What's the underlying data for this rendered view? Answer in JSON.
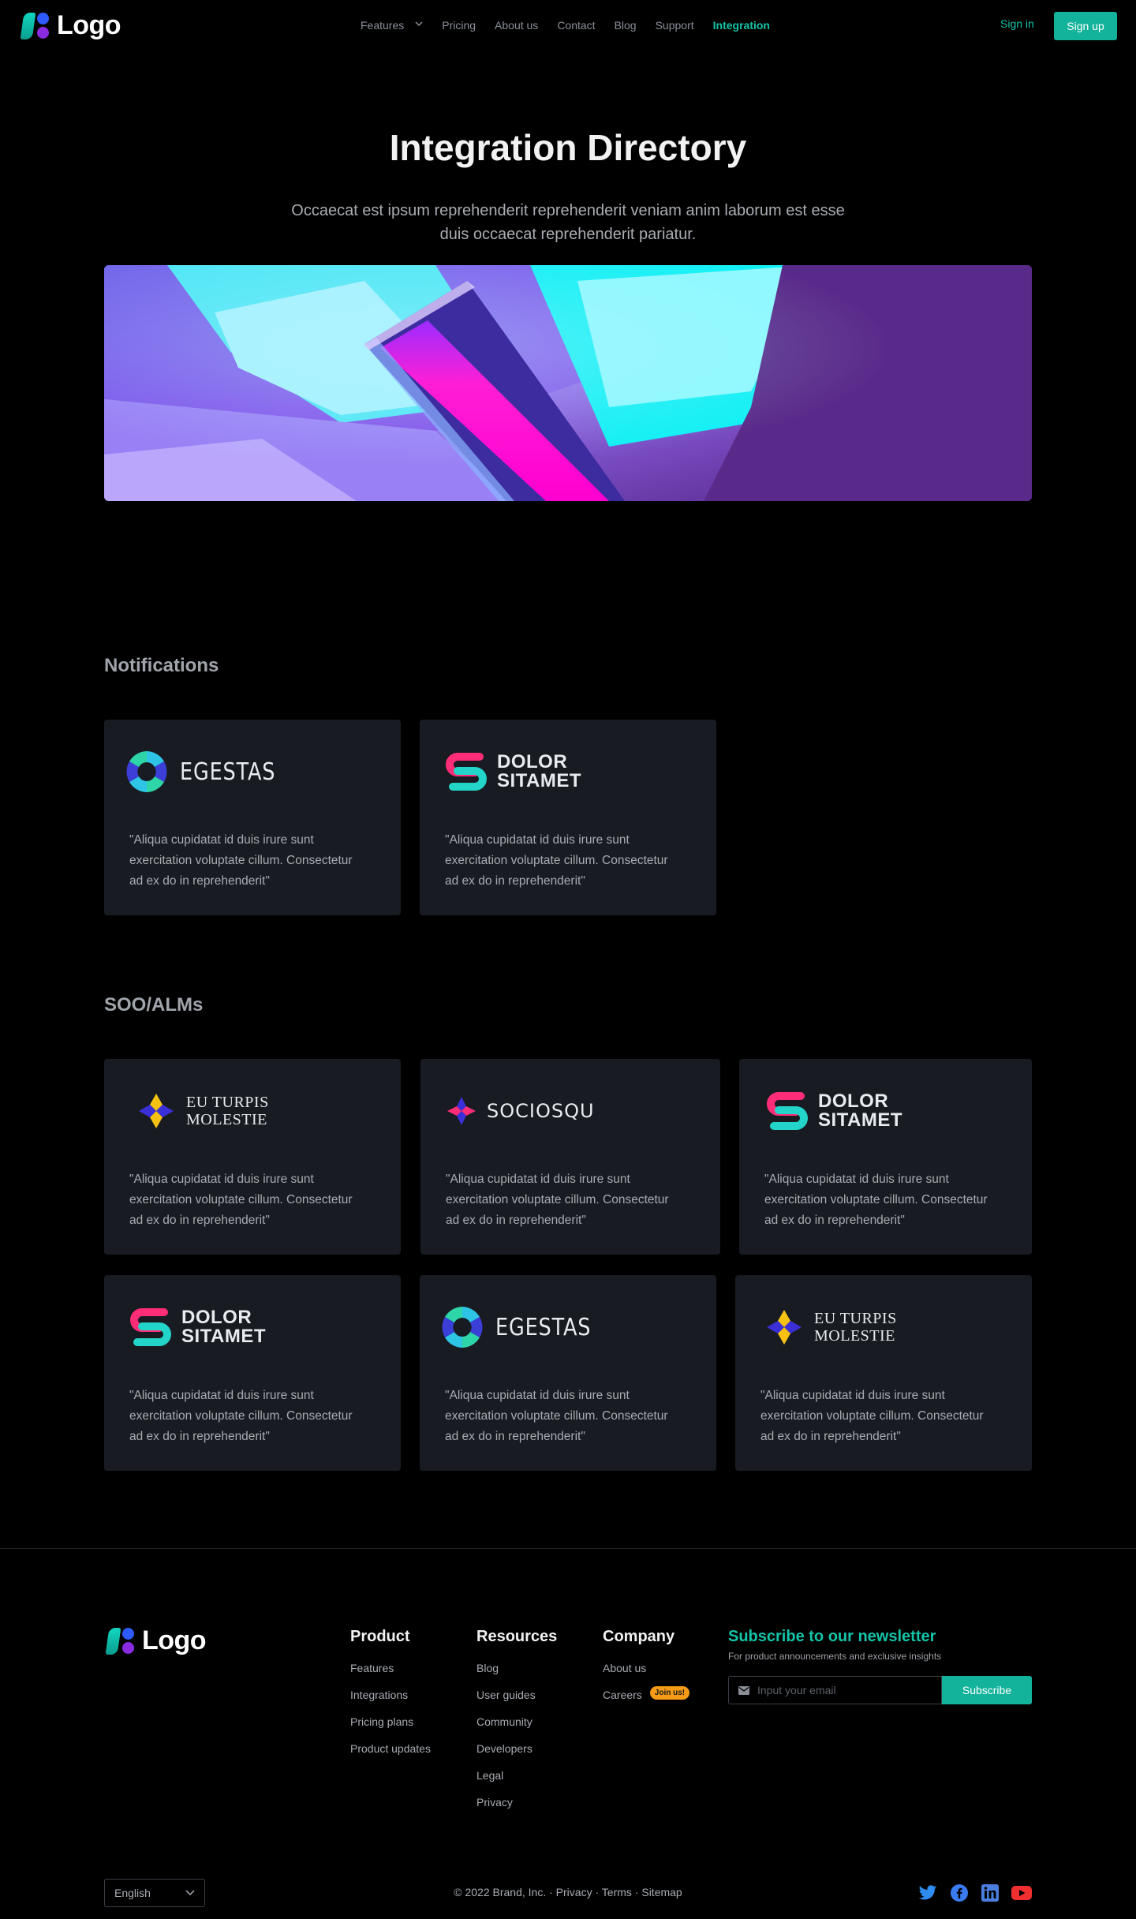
{
  "nav": {
    "logo_text": "Logo",
    "items": [
      {
        "label": "Features"
      },
      {
        "label": "Pricing"
      },
      {
        "label": "About us"
      },
      {
        "label": "Contact"
      },
      {
        "label": "Blog"
      },
      {
        "label": "Support"
      },
      {
        "label": "Integration"
      }
    ],
    "active": "Integration",
    "signin": "Sign in",
    "signup": "Sign up"
  },
  "hero": {
    "title": "Integration Directory",
    "subtitle": "Occaecat est ipsum reprehenderit reprehenderit veniam anim laborum est esse duis occaecat reprehenderit pariatur."
  },
  "sections": [
    {
      "title": "Notifications",
      "cards": [
        {
          "brand_line1": "EGESTAS",
          "brand_line2": "",
          "quote": "\"Aliqua cupidatat id duis irure sunt exercitation voluptate cillum. Consectetur ad ex do in reprehenderit\""
        },
        {
          "brand_line1": "DOLOR",
          "brand_line2": "SITAMET",
          "quote": "\"Aliqua cupidatat id duis irure sunt exercitation voluptate cillum. Consectetur ad ex do in reprehenderit\""
        }
      ]
    },
    {
      "title": "SOO/ALMs",
      "cards": [
        {
          "brand_line1": "EU TURPIS",
          "brand_line2": "MOLESTIE",
          "quote": "\"Aliqua cupidatat id duis irure sunt exercitation voluptate cillum. Consectetur ad ex do in reprehenderit\""
        },
        {
          "brand_line1": "SOCIOSQU",
          "brand_line2": "",
          "quote": "\"Aliqua cupidatat id duis irure sunt exercitation voluptate cillum. Consectetur ad ex do in reprehenderit\""
        },
        {
          "brand_line1": "DOLOR",
          "brand_line2": "SITAMET",
          "quote": "\"Aliqua cupidatat id duis irure sunt exercitation voluptate cillum. Consectetur ad ex do in reprehenderit\""
        },
        {
          "brand_line1": "DOLOR",
          "brand_line2": "SITAMET",
          "quote": "\"Aliqua cupidatat id duis irure sunt exercitation voluptate cillum. Consectetur ad ex do in reprehenderit\""
        },
        {
          "brand_line1": "EGESTAS",
          "brand_line2": "",
          "quote": "\"Aliqua cupidatat id duis irure sunt exercitation voluptate cillum. Consectetur ad ex do in reprehenderit\""
        },
        {
          "brand_line1": "EU TURPIS",
          "brand_line2": "MOLESTIE",
          "quote": "\"Aliqua cupidatat id duis irure sunt exercitation voluptate cillum. Consectetur ad ex do in reprehenderit\""
        }
      ]
    }
  ],
  "footer": {
    "logo_text": "Logo",
    "columns": [
      {
        "title": "Product",
        "links": [
          "Features",
          "Integrations",
          "Pricing plans",
          "Product updates"
        ]
      },
      {
        "title": "Resources",
        "links": [
          "Blog",
          "User guides",
          "Community",
          "Developers",
          "Legal",
          "Privacy"
        ]
      },
      {
        "title": "Company",
        "links": [
          "About us",
          "Careers"
        ],
        "badge": "Join us!"
      }
    ],
    "newsletter": {
      "title": "Subscribe to our newsletter",
      "subtitle": "For product announcements and exclusive insights",
      "placeholder": "Input your email",
      "button": "Subscribe"
    },
    "language": "English",
    "copyright": "© 2022 Brand, Inc.",
    "legal_links": [
      "Privacy",
      "Terms",
      "Sitemap"
    ],
    "social": [
      "twitter-icon",
      "facebook-icon",
      "linkedin-icon",
      "youtube-icon"
    ]
  },
  "colors": {
    "accent": "#13b39b",
    "background": "#000000",
    "card": "#181b21",
    "badge": "#f59b16"
  }
}
